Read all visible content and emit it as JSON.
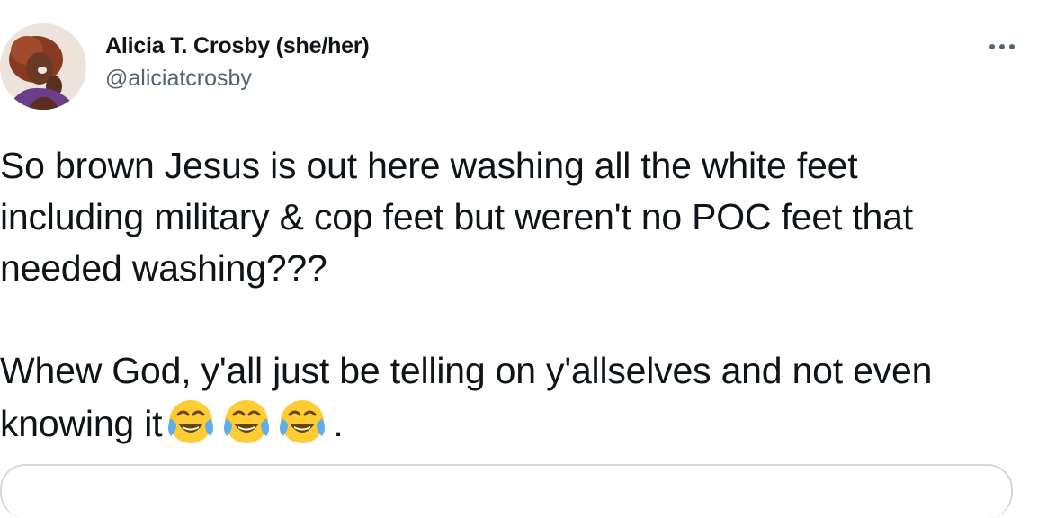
{
  "author": {
    "display_name": "Alicia T. Crosby (she/her)",
    "handle": "@aliciatcrosby",
    "avatar_icon": "profile-photo"
  },
  "more_icon": "ellipsis-icon",
  "tweet": {
    "paragraph_1": "So brown Jesus is out here washing all the white feet including military & cop feet but weren't no POC feet that needed washing???",
    "paragraph_2_text": "Whew God, y'all just be telling on y'allselves and not even knowing it",
    "paragraph_2_end": ".",
    "emoji_icon": "face-with-tears-of-joy-emoji",
    "emoji_count": 3
  },
  "colors": {
    "text": "#0f1419",
    "secondary": "#536471",
    "border": "#cfd9de"
  }
}
